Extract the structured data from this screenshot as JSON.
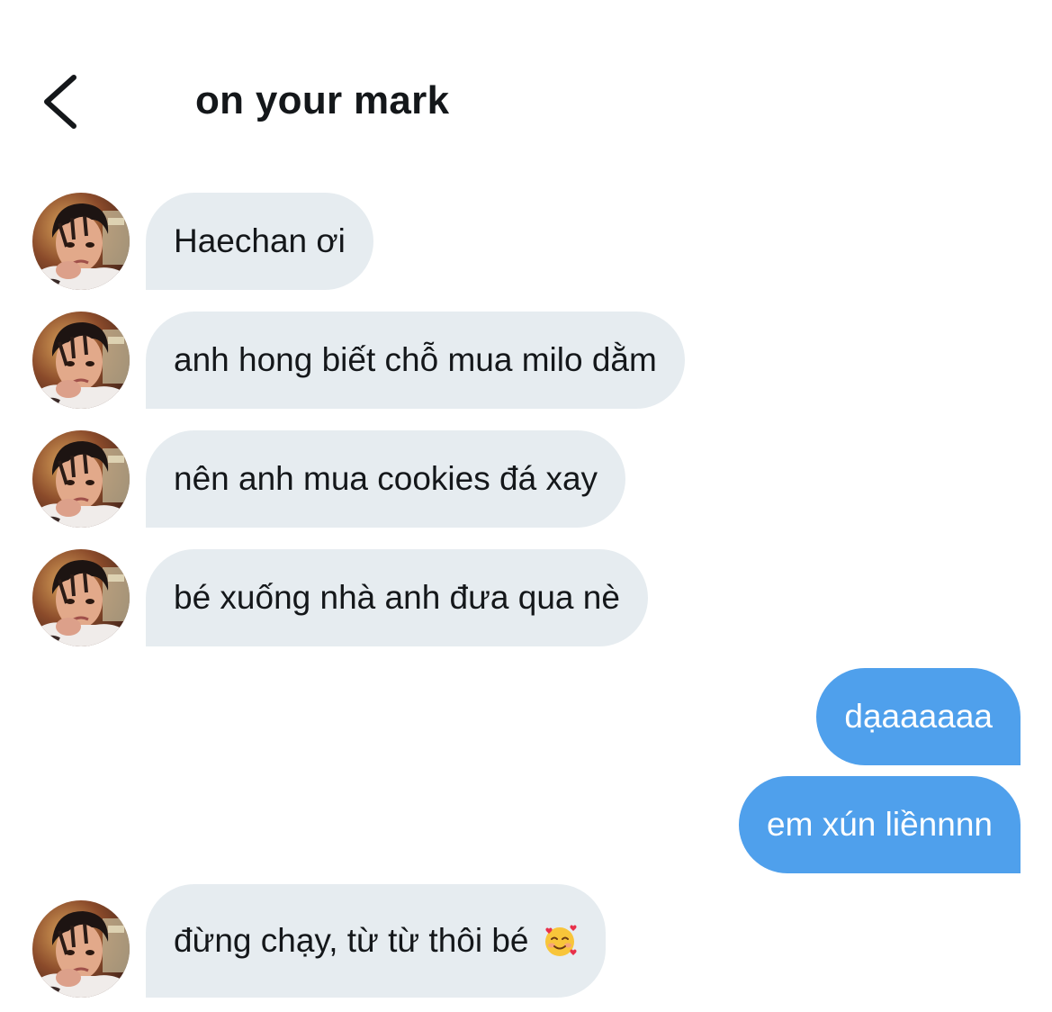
{
  "header": {
    "title": "on your mark",
    "back_icon": "chevron-left-icon"
  },
  "colors": {
    "incoming_bubble": "#e6ecf0",
    "outgoing_bubble": "#4fa0ec",
    "text_dark": "#14171a",
    "text_light": "#ffffff"
  },
  "messages": [
    {
      "direction": "in",
      "text": "Haechan ơi",
      "avatar": true
    },
    {
      "direction": "in",
      "text": "anh hong biết chỗ mua milo dằm",
      "avatar": true
    },
    {
      "direction": "in",
      "text": "nên anh mua cookies đá xay",
      "avatar": true
    },
    {
      "direction": "in",
      "text": "bé xuống nhà anh đưa qua nè",
      "avatar": true
    },
    {
      "direction": "out",
      "text": "dạaaaaaa",
      "avatar": false
    },
    {
      "direction": "out",
      "text": "em xún liềnnnn",
      "avatar": false
    },
    {
      "direction": "in",
      "text": "đừng chạy, từ từ thôi bé",
      "emoji": "smiling-face-with-hearts",
      "avatar": true
    }
  ]
}
